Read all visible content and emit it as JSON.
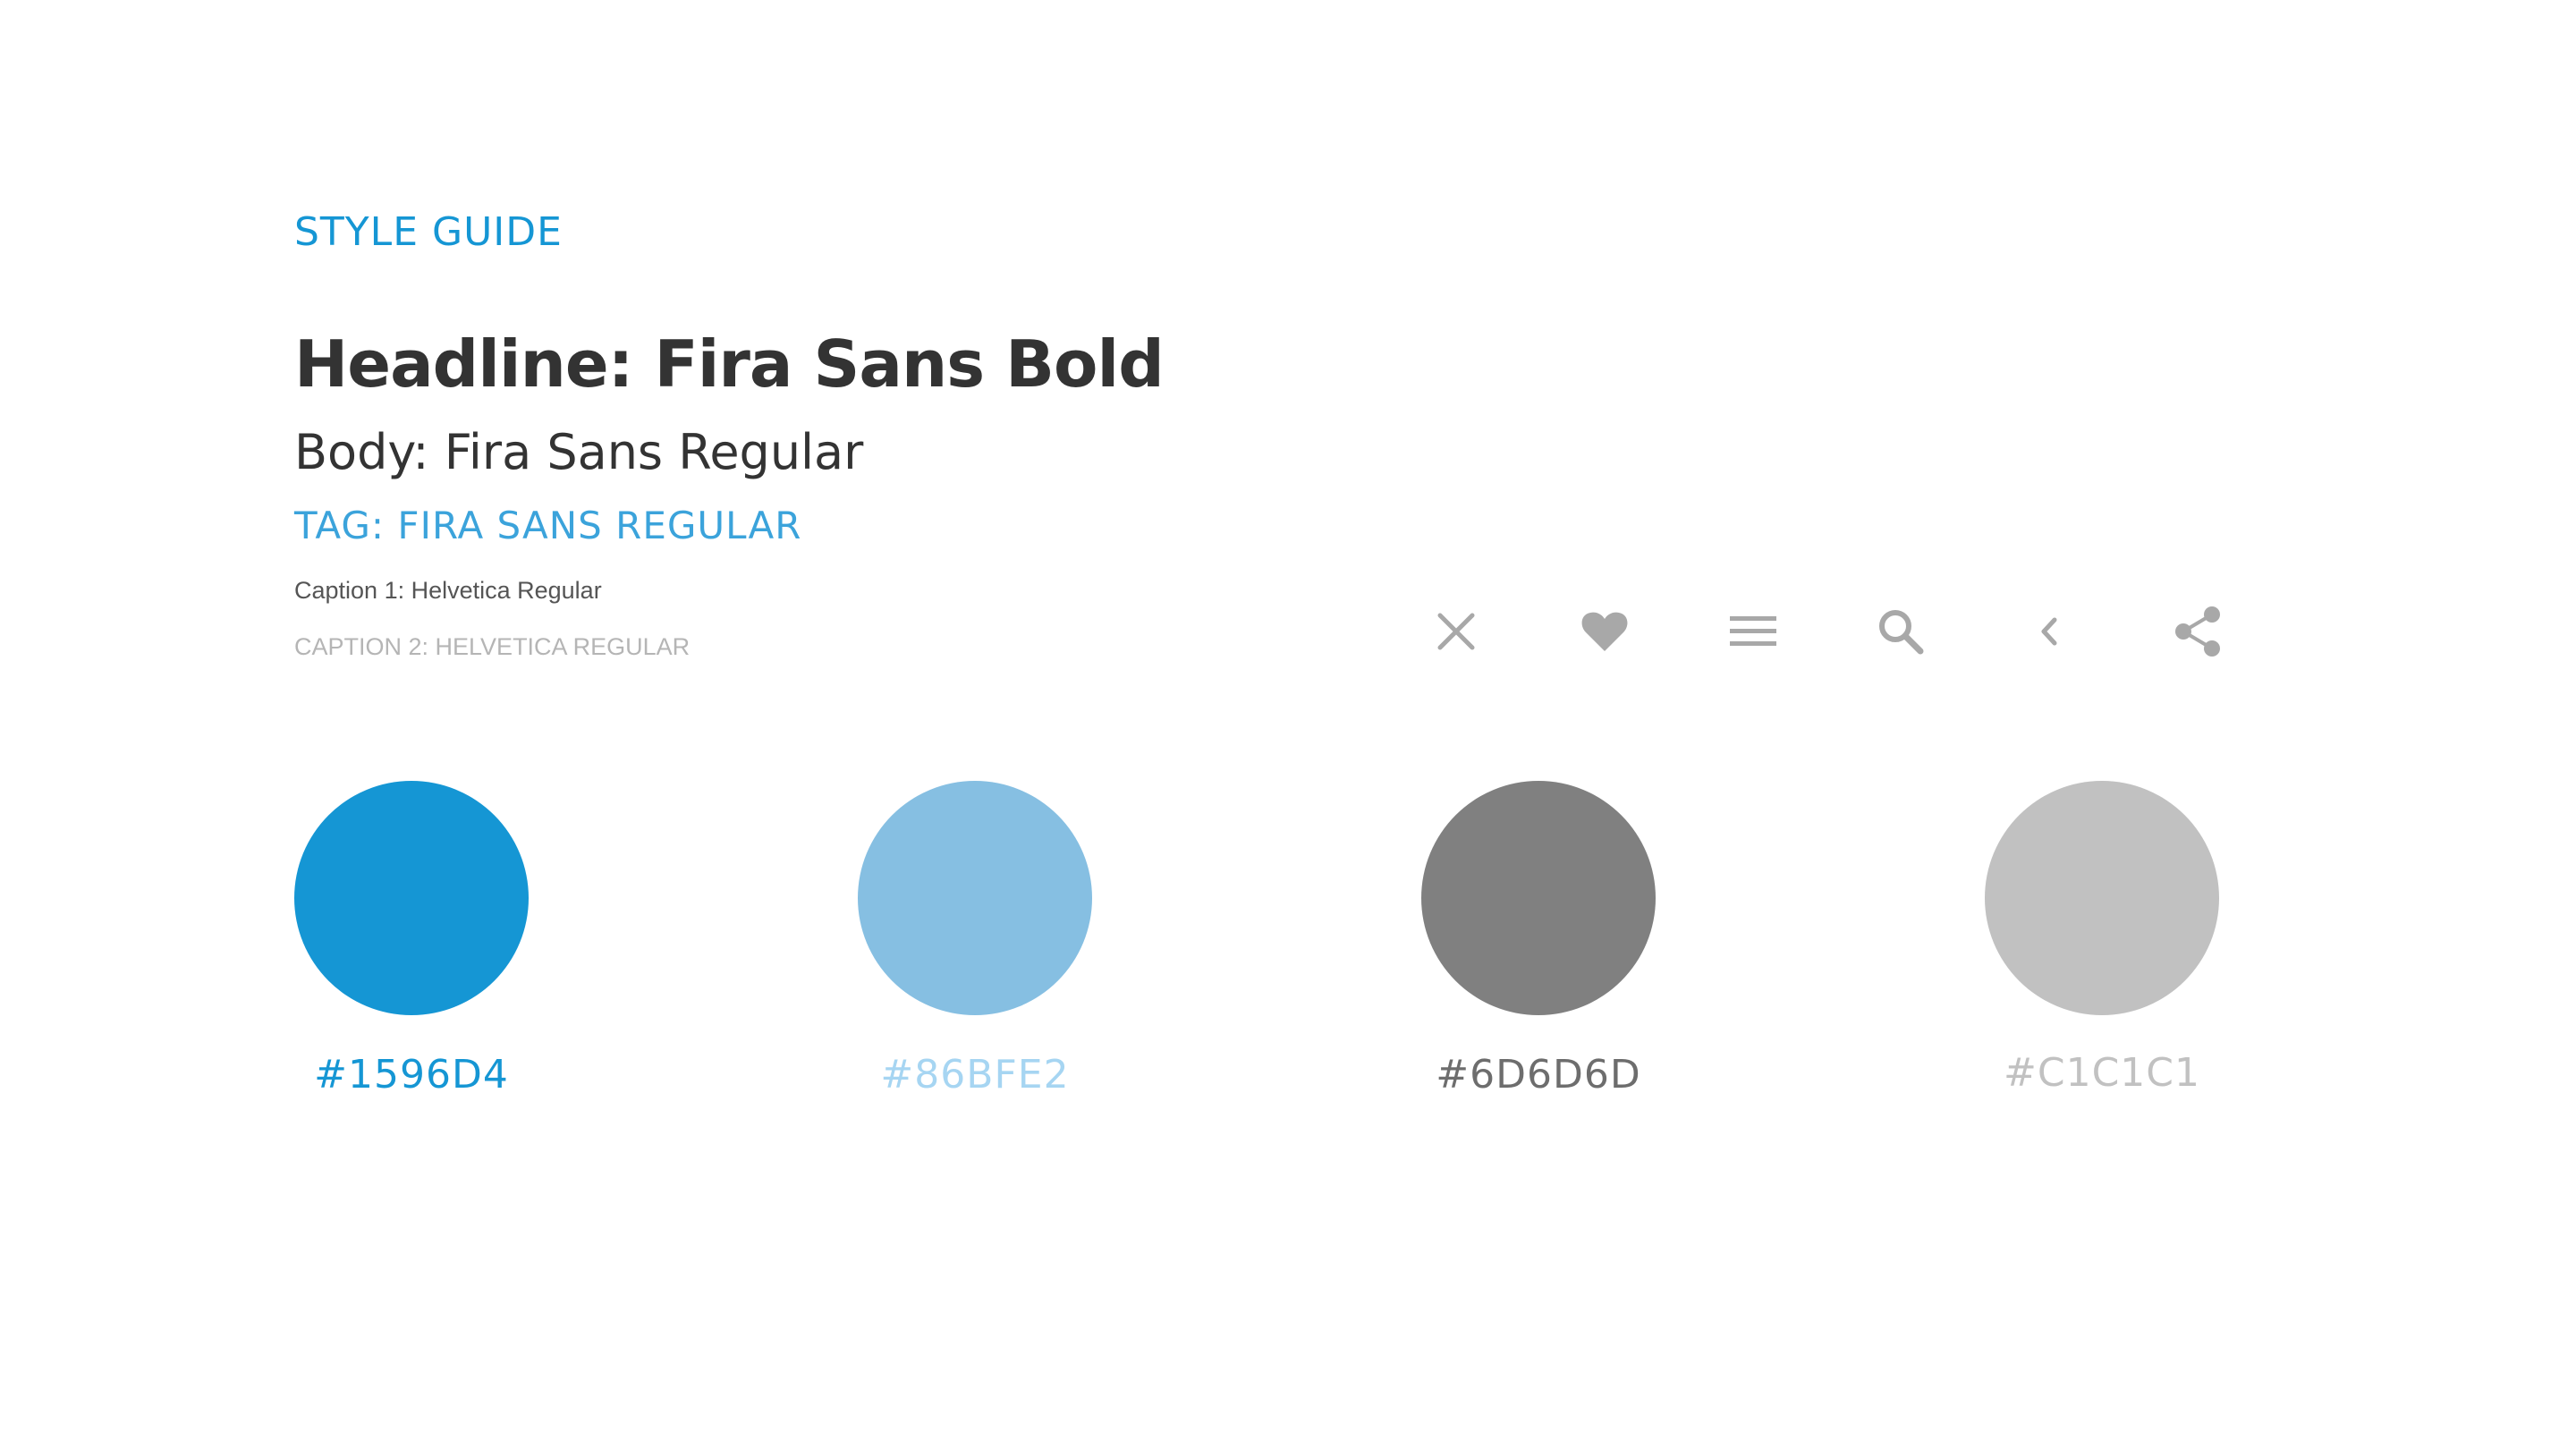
{
  "style_guide": {
    "section_title": "STYLE GUIDE",
    "headline_sample": "Headline: Fira Sans Bold",
    "body_sample": "Body: Fira Sans Regular",
    "tag_sample": "TAG: FIRA SANS REGULAR",
    "caption1_sample": "Caption 1: Helvetica Regular",
    "caption2_sample": "CAPTION 2: HELVETICA REGULAR"
  },
  "accent_colors": {
    "primary": "#1596D4",
    "tag": "#3BA3DB",
    "icon_gray": "#A8A8A8",
    "headline": "#333333"
  },
  "icons": [
    {
      "name": "close-icon"
    },
    {
      "name": "heart-icon"
    },
    {
      "name": "menu-icon"
    },
    {
      "name": "search-icon"
    },
    {
      "name": "chevron-left-icon"
    },
    {
      "name": "share-icon"
    }
  ],
  "palette": [
    {
      "label": "#1596D4",
      "swatch_color": "#1596D4",
      "label_color": "#1596D4"
    },
    {
      "label": "#86BFE2",
      "swatch_color": "#86BFE2",
      "label_color": "#A6D5F2"
    },
    {
      "label": "#6D6D6D",
      "swatch_color": "#808080",
      "label_color": "#6D6D6D"
    },
    {
      "label": "#C1C1C1",
      "swatch_color": "#C1C1C1",
      "label_color": "#C1C1C1"
    }
  ]
}
